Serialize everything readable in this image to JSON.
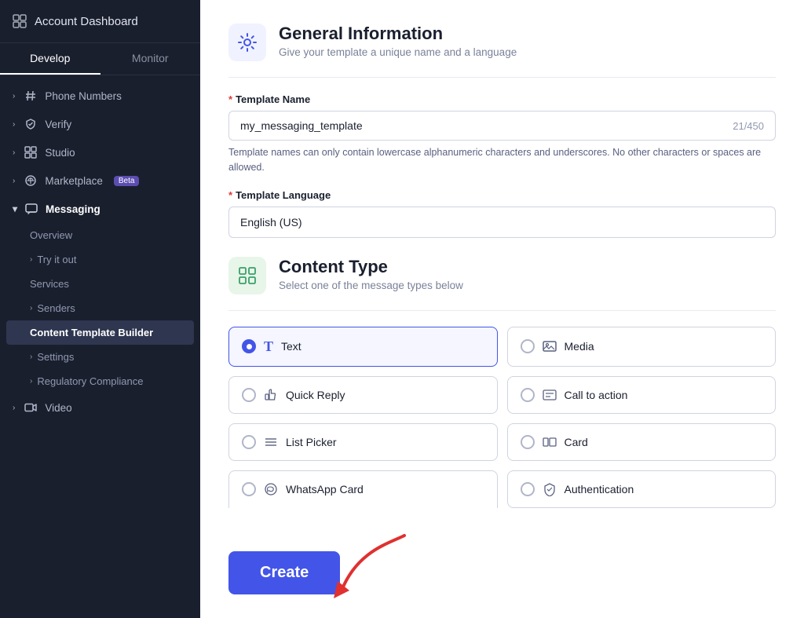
{
  "sidebar": {
    "header": {
      "label": "Account Dashboard",
      "icon": "dashboard-icon"
    },
    "tabs": [
      {
        "label": "Develop",
        "active": true
      },
      {
        "label": "Monitor",
        "active": false
      }
    ],
    "nav_items": [
      {
        "id": "phone-numbers",
        "label": "Phone Numbers",
        "icon": "hash-icon",
        "chevron": true
      },
      {
        "id": "verify",
        "label": "Verify",
        "icon": "shield-icon",
        "chevron": true
      },
      {
        "id": "studio",
        "label": "Studio",
        "icon": "grid-icon",
        "chevron": true
      },
      {
        "id": "marketplace",
        "label": "Marketplace",
        "badge": "Beta",
        "icon": "marketplace-icon",
        "chevron": true
      },
      {
        "id": "messaging",
        "label": "Messaging",
        "icon": "chat-icon",
        "active": true,
        "expanded": true,
        "subitems": [
          {
            "id": "overview",
            "label": "Overview",
            "active": false
          },
          {
            "id": "try-it-out",
            "label": "Try it out",
            "hasChevron": true,
            "active": false
          },
          {
            "id": "services",
            "label": "Services",
            "active": false
          },
          {
            "id": "senders",
            "label": "Senders",
            "hasChevron": true,
            "active": false
          },
          {
            "id": "content-template-builder",
            "label": "Content Template Builder",
            "active": true
          },
          {
            "id": "settings",
            "label": "Settings",
            "hasChevron": true,
            "active": false
          },
          {
            "id": "regulatory-compliance",
            "label": "Regulatory Compliance",
            "hasChevron": true,
            "active": false
          }
        ]
      },
      {
        "id": "video",
        "label": "Video",
        "icon": "video-icon",
        "chevron": true
      }
    ]
  },
  "main": {
    "general_info": {
      "title": "General Information",
      "subtitle": "Give your template a unique name and a language",
      "template_name_label": "Template Name",
      "template_name_required": true,
      "template_name_value": "my_messaging_template",
      "template_name_counter": "21/450",
      "template_name_hint": "Template names can only contain lowercase alphanumeric characters and underscores. No other characters or spaces are allowed.",
      "template_language_label": "Template Language",
      "template_language_required": true,
      "template_language_value": "English (US)"
    },
    "content_type": {
      "title": "Content Type",
      "subtitle": "Select one of the message types below",
      "options": [
        {
          "id": "text",
          "label": "Text",
          "icon": "T",
          "selected": true
        },
        {
          "id": "media",
          "label": "Media",
          "icon": "🖼",
          "selected": false
        },
        {
          "id": "quick-reply",
          "label": "Quick Reply",
          "icon": "👍",
          "selected": false
        },
        {
          "id": "call-to-action",
          "label": "Call to action",
          "icon": "📋",
          "selected": false
        },
        {
          "id": "list-picker",
          "label": "List Picker",
          "icon": "≡",
          "selected": false
        },
        {
          "id": "card",
          "label": "Card",
          "icon": "▯▯",
          "selected": false
        },
        {
          "id": "whatsapp-card",
          "label": "WhatsApp Card",
          "icon": "📱",
          "selected": false
        },
        {
          "id": "authentication",
          "label": "Authentication",
          "icon": "🛡",
          "selected": false
        }
      ]
    },
    "create_button_label": "Create"
  }
}
